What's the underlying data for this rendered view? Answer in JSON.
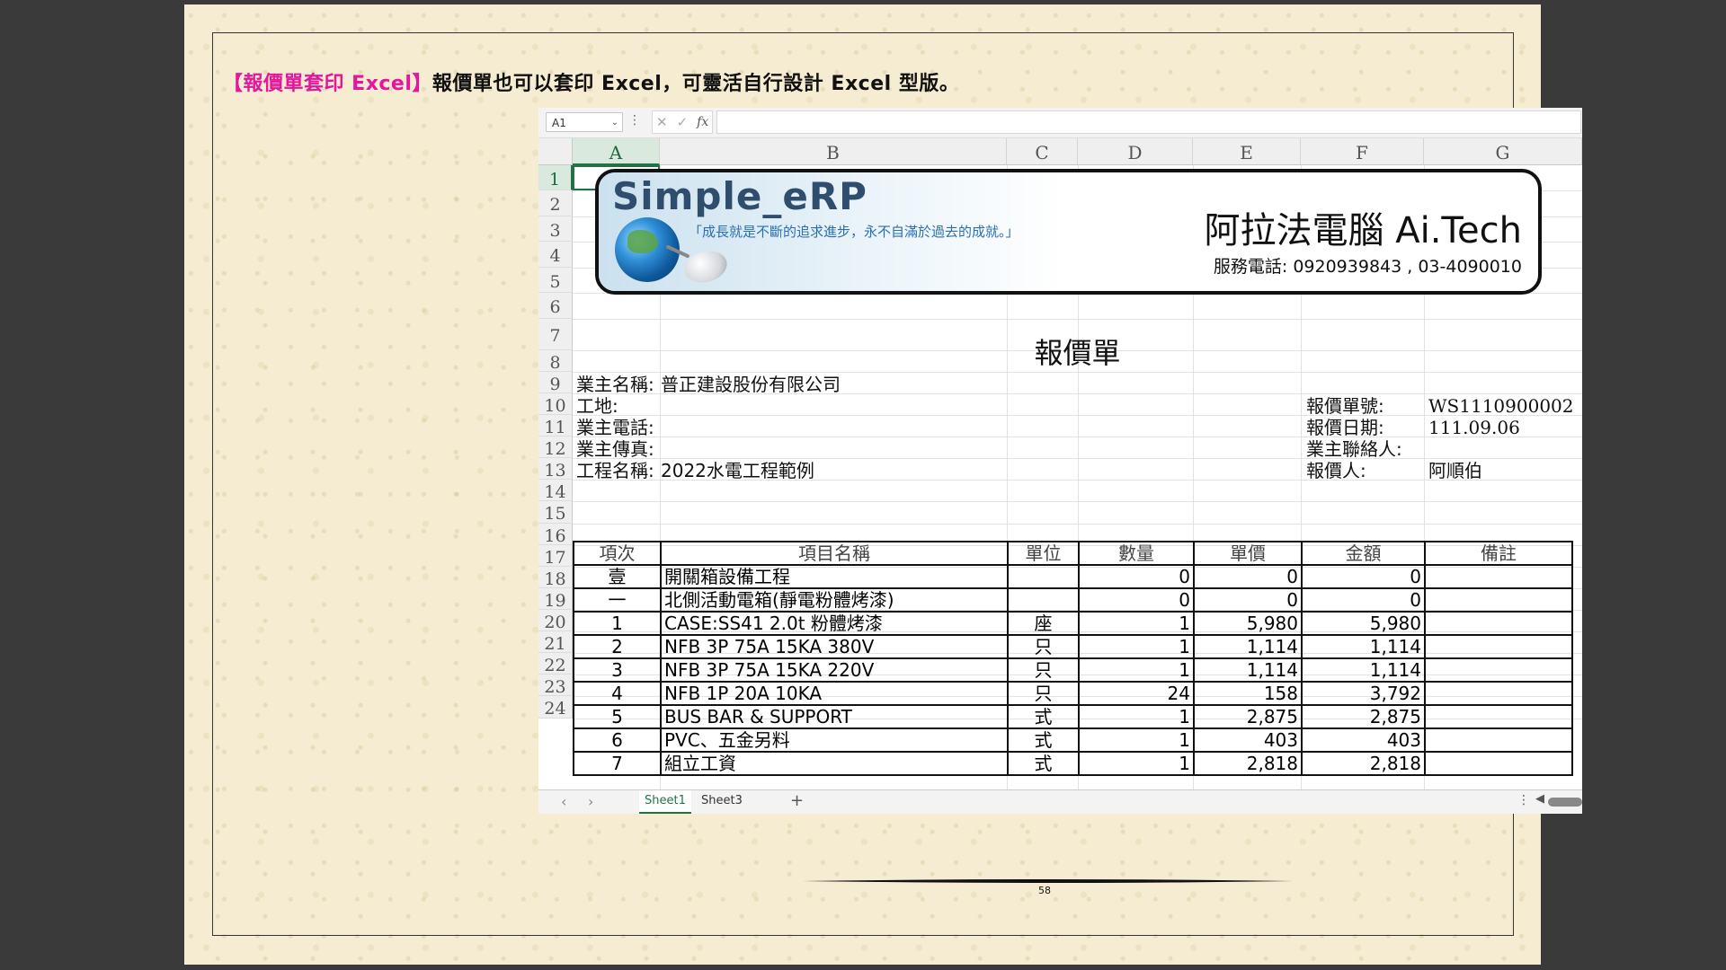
{
  "heading": {
    "bracket_text": "【報價單套印 Excel】",
    "text": "報價單也可以套印 Excel，可靈活自行設計 Excel 型版。"
  },
  "excel": {
    "name_box": "A1",
    "columns": [
      "A",
      "B",
      "C",
      "D",
      "E",
      "F",
      "G"
    ],
    "rows": [
      "1",
      "2",
      "3",
      "4",
      "5",
      "6",
      "7",
      "8",
      "9",
      "10",
      "11",
      "12",
      "13",
      "14",
      "15",
      "16",
      "17",
      "18",
      "19",
      "20",
      "21",
      "22",
      "23",
      "24"
    ],
    "sheets": [
      "Sheet1",
      "Sheet3"
    ],
    "add_sheet": "+",
    "nav_prev": "‹",
    "nav_next": "›"
  },
  "banner": {
    "logo": "Simple_eRP",
    "motto": "「成長就是不斷的追求進步，永不自滿於過去的成就。」",
    "company": "阿拉法電腦 Ai.Tech",
    "phone": "服務電話: 0920939843 , 03-4090010"
  },
  "document": {
    "title": "報價單",
    "owner_label": "業主名稱:",
    "owner_value": "普正建設股份有限公司",
    "site_label": "工地:",
    "owner_phone_label": "業主電話:",
    "owner_fax_label": "業主傳真:",
    "project_label": "工程名稱:",
    "project_value": "2022水電工程範例",
    "quote_no_label": "報價單號:",
    "quote_no": "WS1110900002",
    "quote_date_label": "報價日期:",
    "quote_date": "111.09.06",
    "contact_label": "業主聯絡人:",
    "quoter_label": "報價人:",
    "quoter": "阿順伯"
  },
  "table": {
    "headers": [
      "項次",
      "項目名稱",
      "單位",
      "數量",
      "單價",
      "金額",
      "備註"
    ],
    "rows": [
      {
        "item": "壹",
        "name": "開關箱設備工程",
        "unit": "",
        "qty": "0",
        "price": "0",
        "amount": "0",
        "note": ""
      },
      {
        "item": "一",
        "name": "北側活動電箱(靜電粉體烤漆)",
        "unit": "",
        "qty": "0",
        "price": "0",
        "amount": "0",
        "note": ""
      },
      {
        "item": "1",
        "name": "CASE:SS41 2.0t  粉體烤漆",
        "unit": "座",
        "qty": "1",
        "price": "5,980",
        "amount": "5,980",
        "note": ""
      },
      {
        "item": "2",
        "name": "NFB 3P 75A  15KA 380V",
        "unit": "只",
        "qty": "1",
        "price": "1,114",
        "amount": "1,114",
        "note": ""
      },
      {
        "item": "3",
        "name": "NFB 3P 75A  15KA 220V",
        "unit": "只",
        "qty": "1",
        "price": "1,114",
        "amount": "1,114",
        "note": ""
      },
      {
        "item": "4",
        "name": "NFB 1P 20A 10KA",
        "unit": "只",
        "qty": "24",
        "price": "158",
        "amount": "3,792",
        "note": ""
      },
      {
        "item": "5",
        "name": "BUS BAR & SUPPORT",
        "unit": "式",
        "qty": "1",
        "price": "2,875",
        "amount": "2,875",
        "note": ""
      },
      {
        "item": "6",
        "name": "PVC、五金另料",
        "unit": "式",
        "qty": "1",
        "price": "403",
        "amount": "403",
        "note": ""
      },
      {
        "item": "7",
        "name": "組立工資",
        "unit": "式",
        "qty": "1",
        "price": "2,818",
        "amount": "2,818",
        "note": ""
      }
    ]
  },
  "page_number": "58"
}
